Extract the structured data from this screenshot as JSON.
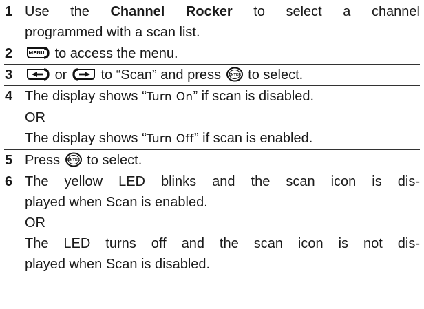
{
  "steps": [
    {
      "number": "1",
      "pre": "Use the",
      "bold": "Channel Rocker",
      "post": "to select a channel",
      "line2": "programmed with a scan list."
    },
    {
      "number": "2",
      "key_label": "MENU",
      "text": "to access the menu."
    },
    {
      "number": "3",
      "or_text": "or",
      "text_to": "to “Scan” and press",
      "enter_label": "ENTER",
      "text_end": "to select."
    },
    {
      "number": "4",
      "line1_pre": "The display shows “",
      "line1_code": "Turn On",
      "line1_post": "” if scan is disabled.",
      "or": "OR",
      "line3_pre": "The display shows “",
      "line3_code": "Turn Off",
      "line3_post": "” if scan is enabled."
    },
    {
      "number": "5",
      "pre": "Press",
      "enter_label": "ENTER",
      "post": "to select."
    },
    {
      "number": "6",
      "line1": "The yellow LED blinks and the scan icon is dis-",
      "line2": "played when Scan is enabled.",
      "or": "OR",
      "line4": "The LED turns off and the scan icon is not dis-",
      "line5": "played when Scan is disabled."
    }
  ]
}
